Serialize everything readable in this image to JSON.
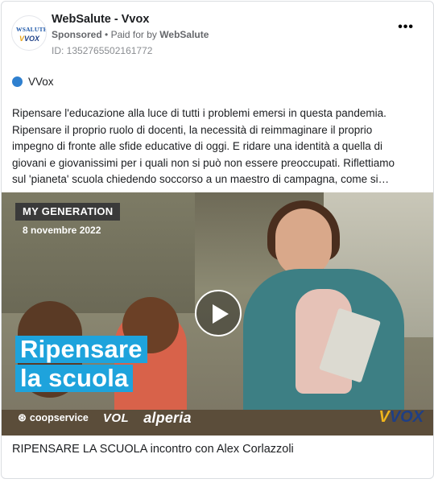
{
  "ad": {
    "page_name": "WebSalute - Vvox",
    "sponsored_label": "Sponsored",
    "paid_for_prefix": "Paid for by",
    "paid_for_by": "WebSalute",
    "ad_id": "ID: 1352765502161772",
    "more_icon": "more-options-icon",
    "avatar_logo": {
      "top": "WSALUTE",
      "bottom_v": "V",
      "bottom_rest": "VOX"
    }
  },
  "platform": {
    "label": "VVox",
    "dot_color": "#2f80cf"
  },
  "body": {
    "lines": [
      "Ripensare l'educazione alla luce di tutti i problemi emersi in questa pandemia.",
      "Ripensare il proprio ruolo di docenti, la necessità di reimmaginare il proprio",
      "impegno di fronte alle sfide educative di oggi. E ridare una identità a quella di",
      "giovani e giovanissimi per i quali non si può non essere preoccupati. Riflettiamo",
      "sul 'pianeta' scuola chiedendo soccorso a un maestro di campagna, come si…"
    ]
  },
  "media": {
    "tag": "MY GENERATION",
    "date": "8 novembre 2022",
    "title_line1": "Ripensare",
    "title_line2": "la scuola",
    "play_icon": "play-icon",
    "sponsors": [
      "coopservice",
      "VOL",
      "alperia"
    ],
    "brand_mark_v": "V",
    "brand_mark_rest": "VOX",
    "accent_color": "#1ea3dc"
  },
  "caption": "RIPENSARE LA SCUOLA incontro con Alex Corlazzoli"
}
